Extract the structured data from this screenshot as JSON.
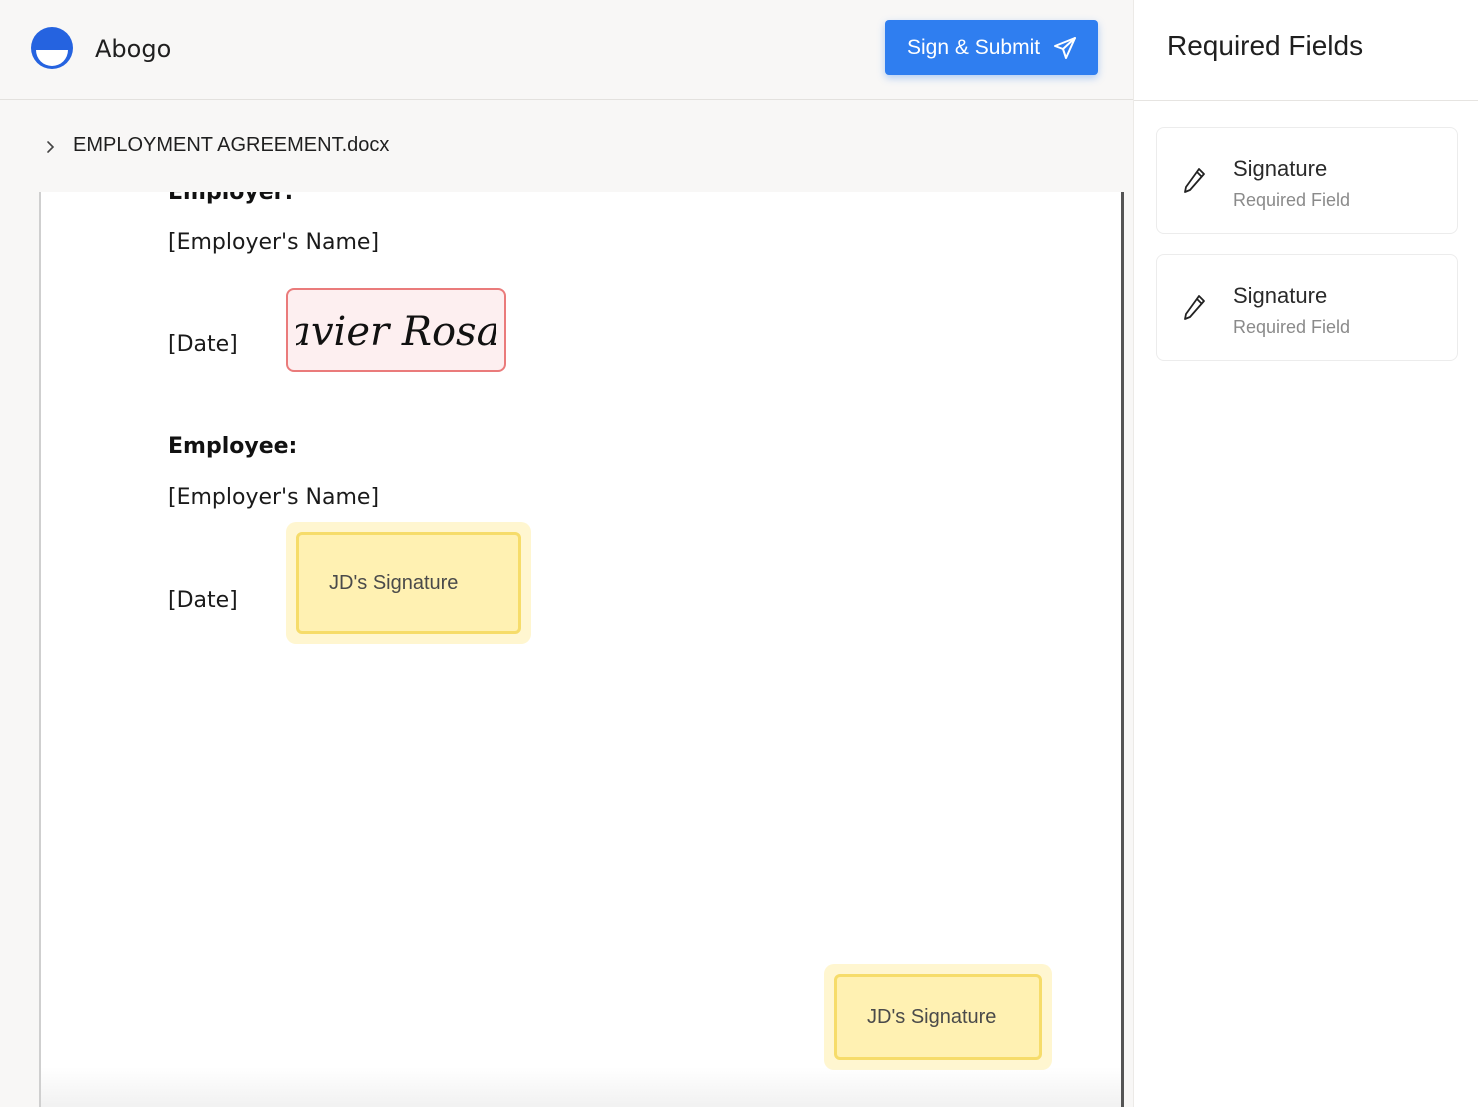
{
  "header": {
    "app_name": "Abogo",
    "submit_label": "Sign & Submit"
  },
  "breadcrumb": {
    "filename": "EMPLOYMENT AGREEMENT.docx"
  },
  "document": {
    "employer_heading": "Employer:",
    "employer_name": "[Employer's Name]",
    "employer_date": "[Date]",
    "employer_signature_text": "Javier Rosas",
    "employee_heading": "Employee:",
    "employee_name": "[Employer's Name]",
    "employee_date": "[Date]",
    "pending_signature_1": "JD's Signature",
    "pending_signature_2": "JD's Signature"
  },
  "panel": {
    "title": "Required Fields",
    "fields": [
      {
        "label": "Signature",
        "sub": "Required Field"
      },
      {
        "label": "Signature",
        "sub": "Required Field"
      }
    ]
  },
  "colors": {
    "accent": "#2f7ef0",
    "signed_border": "#ea7b7b",
    "pending_fill": "#fff1b2"
  }
}
